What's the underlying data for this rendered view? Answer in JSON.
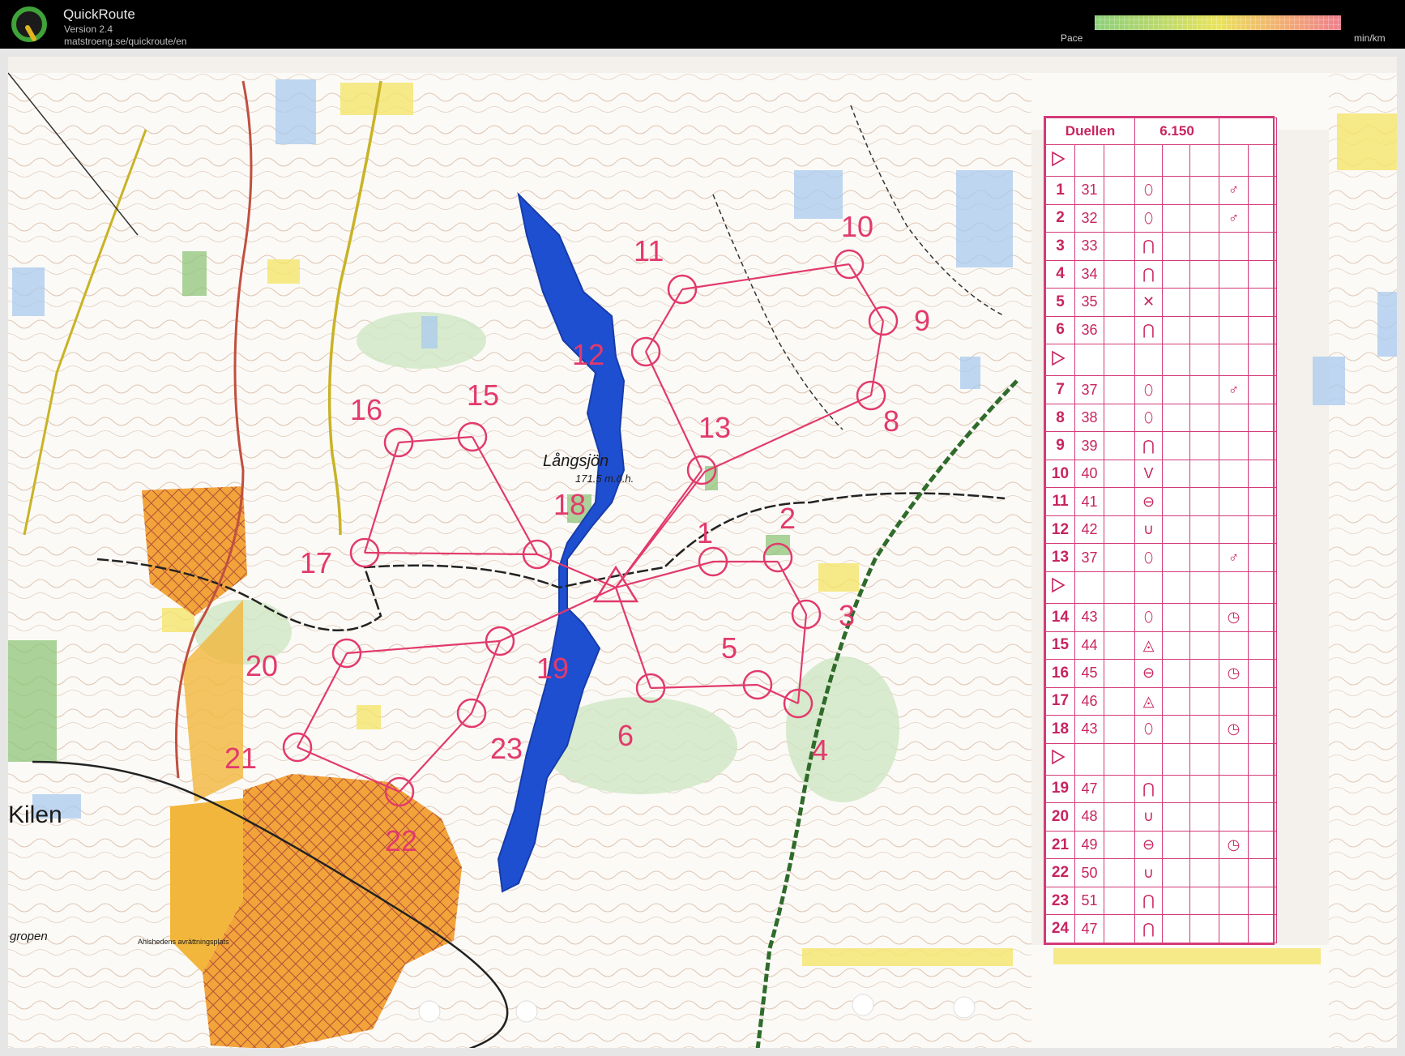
{
  "app": {
    "title": "QuickRoute",
    "version": "Version 2.4",
    "url": "matstroeng.se/quickroute/en",
    "pace_label": "Pace",
    "pace_unit": "min/km",
    "colors": {
      "course": "#e23a6c",
      "water": "#1f4fd1",
      "forest_open": "#f0a030",
      "path": "#1a1a1a"
    }
  },
  "map": {
    "place_labels": [
      "Långsjön",
      "171.5 m.ö.h.",
      "Kilen",
      "gropen",
      "Ahlshedens avrättningsplats"
    ],
    "controls": [
      {
        "label": "1"
      },
      {
        "label": "2"
      },
      {
        "label": "3"
      },
      {
        "label": "4"
      },
      {
        "label": "5"
      },
      {
        "label": "6"
      },
      {
        "label": "8"
      },
      {
        "label": "9"
      },
      {
        "label": "10"
      },
      {
        "label": "11"
      },
      {
        "label": "12"
      },
      {
        "label": "13"
      },
      {
        "label": "15"
      },
      {
        "label": "16"
      },
      {
        "label": "17"
      },
      {
        "label": "18"
      },
      {
        "label": "19"
      },
      {
        "label": "20"
      },
      {
        "label": "21"
      },
      {
        "label": "22"
      },
      {
        "label": "23"
      }
    ]
  },
  "card": {
    "title": "Duellen",
    "length": "6.150",
    "rows": [
      {
        "type": "start"
      },
      {
        "type": "control",
        "num": "1",
        "code": "31",
        "feature": "⬯",
        "extra": "♂"
      },
      {
        "type": "control",
        "num": "2",
        "code": "32",
        "feature": "⬯",
        "extra": "♂"
      },
      {
        "type": "control",
        "num": "3",
        "code": "33",
        "feature": "⋂",
        "extra": ""
      },
      {
        "type": "control",
        "num": "4",
        "code": "34",
        "feature": "⋂",
        "extra": ""
      },
      {
        "type": "control",
        "num": "5",
        "code": "35",
        "feature": "✕",
        "extra": ""
      },
      {
        "type": "control",
        "num": "6",
        "code": "36",
        "feature": "⋂",
        "extra": ""
      },
      {
        "type": "start"
      },
      {
        "type": "control",
        "num": "7",
        "code": "37",
        "feature": "⬯",
        "extra": "♂"
      },
      {
        "type": "control",
        "num": "8",
        "code": "38",
        "feature": "⬯",
        "extra": ""
      },
      {
        "type": "control",
        "num": "9",
        "code": "39",
        "feature": "⋂",
        "extra": ""
      },
      {
        "type": "control",
        "num": "10",
        "code": "40",
        "feature": "V",
        "extra": ""
      },
      {
        "type": "control",
        "num": "11",
        "code": "41",
        "feature": "⊖",
        "extra": ""
      },
      {
        "type": "control",
        "num": "12",
        "code": "42",
        "feature": "∪",
        "extra": ""
      },
      {
        "type": "control",
        "num": "13",
        "code": "37",
        "feature": "⬯",
        "extra": "♂"
      },
      {
        "type": "start"
      },
      {
        "type": "control",
        "num": "14",
        "code": "43",
        "feature": "⬯",
        "extra": "◷"
      },
      {
        "type": "control",
        "num": "15",
        "code": "44",
        "feature": "◬",
        "extra": ""
      },
      {
        "type": "control",
        "num": "16",
        "code": "45",
        "feature": "⊖",
        "extra": "◷"
      },
      {
        "type": "control",
        "num": "17",
        "code": "46",
        "feature": "◬",
        "extra": ""
      },
      {
        "type": "control",
        "num": "18",
        "code": "43",
        "feature": "⬯",
        "extra": "◷"
      },
      {
        "type": "start"
      },
      {
        "type": "control",
        "num": "19",
        "code": "47",
        "feature": "⋂",
        "extra": ""
      },
      {
        "type": "control",
        "num": "20",
        "code": "48",
        "feature": "∪",
        "extra": ""
      },
      {
        "type": "control",
        "num": "21",
        "code": "49",
        "feature": "⊖",
        "extra": "◷"
      },
      {
        "type": "control",
        "num": "22",
        "code": "50",
        "feature": "∪",
        "extra": ""
      },
      {
        "type": "control",
        "num": "23",
        "code": "51",
        "feature": "⋂",
        "extra": ""
      },
      {
        "type": "control",
        "num": "24",
        "code": "47",
        "feature": "⋂",
        "extra": ""
      }
    ]
  }
}
